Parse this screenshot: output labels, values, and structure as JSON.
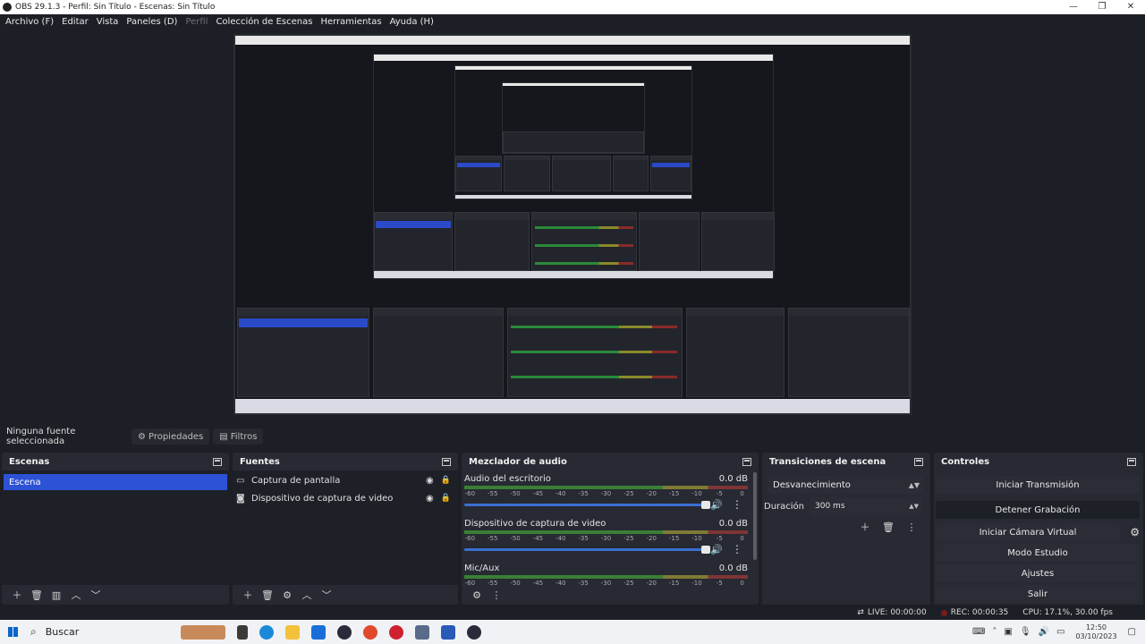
{
  "window": {
    "title": "OBS 29.1.3 - Perfil: Sin Título - Escenas: Sin Título",
    "minimize_glyph": "—",
    "maximize_glyph": "❐",
    "close_glyph": "✕"
  },
  "menu": {
    "items": [
      "Archivo (F)",
      "Editar",
      "Vista",
      "Paneles (D)",
      "Perfil",
      "Colección de Escenas",
      "Herramientas",
      "Ayuda (H)"
    ],
    "disabled_index": 4
  },
  "properties_bar": {
    "no_source": "Ninguna fuente seleccionada",
    "properties_label": "Propiedades",
    "filters_label": "Filtros"
  },
  "scenes": {
    "title": "Escenas",
    "items": [
      "Escena"
    ]
  },
  "sources": {
    "title": "Fuentes",
    "items": [
      {
        "label": "Captura de pantalla",
        "icon": "monitor-icon"
      },
      {
        "label": "Dispositivo de captura de video",
        "icon": "camera-icon"
      }
    ]
  },
  "mixer": {
    "title": "Mezclador de audio",
    "ticks": [
      "-60",
      "-55",
      "-50",
      "-45",
      "-40",
      "-35",
      "-30",
      "-25",
      "-20",
      "-15",
      "-10",
      "-5",
      "0"
    ],
    "channels": [
      {
        "name": "Audio del escritorio",
        "db": "0.0 dB"
      },
      {
        "name": "Dispositivo de captura de video",
        "db": "0.0 dB"
      },
      {
        "name": "Mic/Aux",
        "db": "0.0 dB"
      }
    ]
  },
  "transitions": {
    "title": "Transiciones de escena",
    "selected": "Desvanecimiento",
    "duration_label": "Duración",
    "duration_value": "300 ms"
  },
  "controls": {
    "title": "Controles",
    "start_stream": "Iniciar Transmisión",
    "stop_recording": "Detener Grabación",
    "start_virtual_cam": "Iniciar Cámara Virtual",
    "studio_mode": "Modo Estudio",
    "settings": "Ajustes",
    "exit": "Salir"
  },
  "status": {
    "live": "LIVE: 00:00:00",
    "rec": "REC: 00:00:35",
    "cpu": "CPU: 17.1%, 30.00 fps"
  },
  "taskbar": {
    "search_placeholder": "Buscar",
    "time": "12:50",
    "date": "03/10/2023"
  },
  "colors": {
    "accent": "#2d52d6",
    "background": "#1d1f26",
    "dock": "#272a33"
  }
}
